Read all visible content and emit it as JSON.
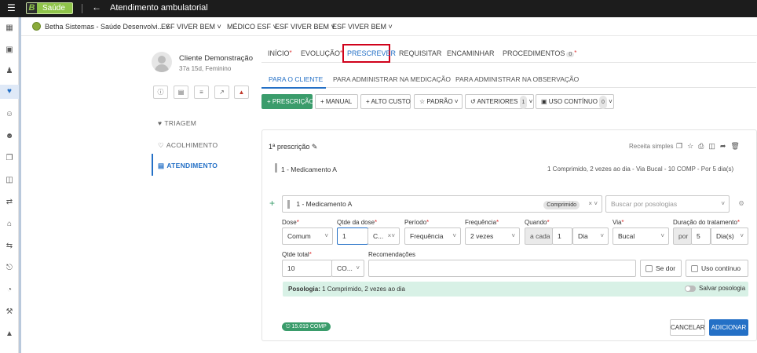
{
  "topbar": {
    "app_name": "Saúde",
    "logo_letter": "B",
    "title": "Atendimento ambulatorial"
  },
  "context": {
    "org": "Betha Sistemas - Saúde Desenvolvi...",
    "items": [
      "ESF VIVER BEM",
      "MÉDICO ESF",
      "ESF VIVER BEM",
      "ESF VIVER BEM"
    ]
  },
  "patient": {
    "name": "Cliente Demonstração",
    "sub": "37a 15d, Feminino"
  },
  "leftnav": {
    "triagem": "TRIAGEM",
    "acolhimento": "ACOLHIMENTO",
    "atendimento": "ATENDIMENTO"
  },
  "tabs": {
    "inicio": "INÍCIO",
    "evolucao": "EVOLUÇÃO",
    "prescrever": "PRESCREVER",
    "requisitar": "REQUISITAR",
    "encaminhar": "ENCAMINHAR",
    "procedimentos": "PROCEDIMENTOS",
    "procedimentos_count": "0"
  },
  "subtabs": {
    "cliente": "PARA O CLIENTE",
    "medicacao": "PARA ADMINISTRAR NA MEDICAÇÃO",
    "observacao": "PARA ADMINISTRAR NA OBSERVAÇÃO"
  },
  "toolbar": {
    "prescricao": "+ PRESCRIÇÃO",
    "manual": "MANUAL",
    "alto_custo": "ALTO CUSTO",
    "padrao": "PADRÃO",
    "anteriores": "ANTERIORES",
    "anteriores_count": "1",
    "uso_continuo": "USO CONTÍNUO",
    "uso_continuo_count": "0"
  },
  "prescription": {
    "title": "1ª prescrição",
    "receita": "Receita simples",
    "item_name": "1 - Medicamento A",
    "item_desc": "1 Comprimido, 2 vezes ao dia - Via Bucal - 10 COMP - Por 5 dia(s)"
  },
  "form": {
    "med_value": "1 - Medicamento A",
    "med_pill": "Comprimido",
    "posologia_placeholder": "Buscar por posologias",
    "dose_label": "Dose",
    "dose_value": "Comum",
    "qtde_dose_label": "Qtde da dose",
    "qtde_dose_value": "1",
    "qtde_dose_unit": "C...",
    "periodo_label": "Período",
    "periodo_value": "Frequência",
    "frequencia_label": "Frequência",
    "frequencia_value": "2 vezes",
    "quando_label": "Quando",
    "quando_prefix": "a cada",
    "quando_value": "1",
    "quando_unit": "Dia",
    "via_label": "Via",
    "via_value": "Bucal",
    "duracao_label": "Duração do tratamento",
    "duracao_prefix": "por",
    "duracao_value": "5",
    "duracao_unit": "Dia(s)",
    "qtde_total_label": "Qtde total",
    "qtde_total_value": "10",
    "qtde_total_unit": "CO...",
    "recomendacoes_label": "Recomendações",
    "se_dor": "Se dor",
    "uso_continuo": "Uso contínuo"
  },
  "posologia": {
    "label": "Posologia:",
    "value": "1 Comprimido, 2 vezes ao dia",
    "salvar": "Salvar posologia"
  },
  "footer": {
    "stock": "15.019 COMP",
    "cancelar": "CANCELAR",
    "adicionar": "ADICIONAR"
  },
  "colors": {
    "accent": "#2470c6",
    "green": "#3a9c6b",
    "highlight_border": "#d0021b"
  }
}
